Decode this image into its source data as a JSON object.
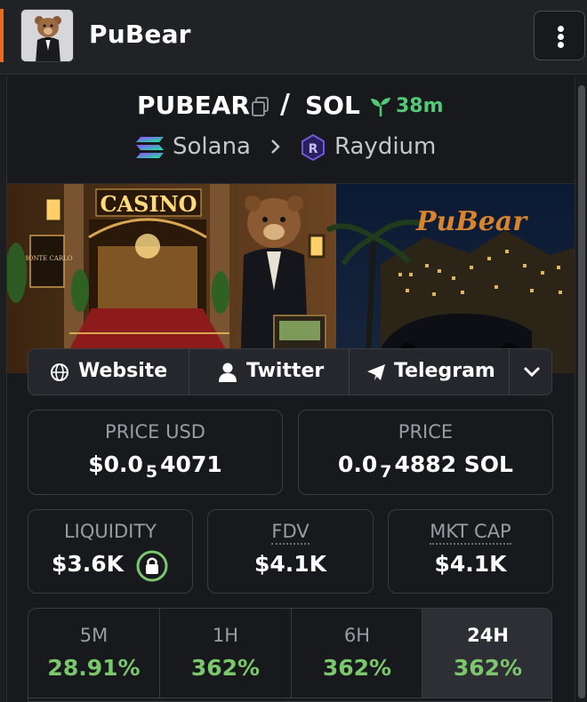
{
  "header": {
    "title": "PuBear",
    "avatar_icon": "bear-avatar-icon",
    "menu_icon": "more-vertical-icon"
  },
  "pair": {
    "base": "PUBEAR",
    "separator": "/",
    "quote": "SOL",
    "age": "38m",
    "age_color": "#52c977",
    "chain": "Solana",
    "dex": "Raydium"
  },
  "banner": {
    "sign_text": "CASINO",
    "plaque_text": "MONTE CARLO",
    "brand_text": "PuBear"
  },
  "socials": [
    {
      "label": "Website",
      "icon": "globe-icon"
    },
    {
      "label": "Twitter",
      "icon": "user-icon"
    },
    {
      "label": "Telegram",
      "icon": "telegram-icon"
    }
  ],
  "stats": {
    "price_usd": {
      "label": "PRICE USD",
      "prefix": "$0.0",
      "zeros": "5",
      "suffix": "4071"
    },
    "price": {
      "label": "PRICE",
      "prefix": "0.0",
      "zeros": "7",
      "suffix": "4882 SOL"
    },
    "liquidity": {
      "label": "LIQUIDITY",
      "value": "$3.6K",
      "lock_color": "#7bc86c"
    },
    "fdv": {
      "label": "FDV",
      "value": "$4.1K"
    },
    "mkt_cap": {
      "label": "MKT CAP",
      "value": "$4.1K"
    }
  },
  "changes": [
    {
      "label": "5M",
      "value": "28.91%"
    },
    {
      "label": "1H",
      "value": "362%"
    },
    {
      "label": "6H",
      "value": "362%"
    },
    {
      "label": "24H",
      "value": "362%"
    }
  ],
  "colors": {
    "accent": "#f06a1c",
    "positive": "#7bc86c",
    "background": "#18191d"
  }
}
